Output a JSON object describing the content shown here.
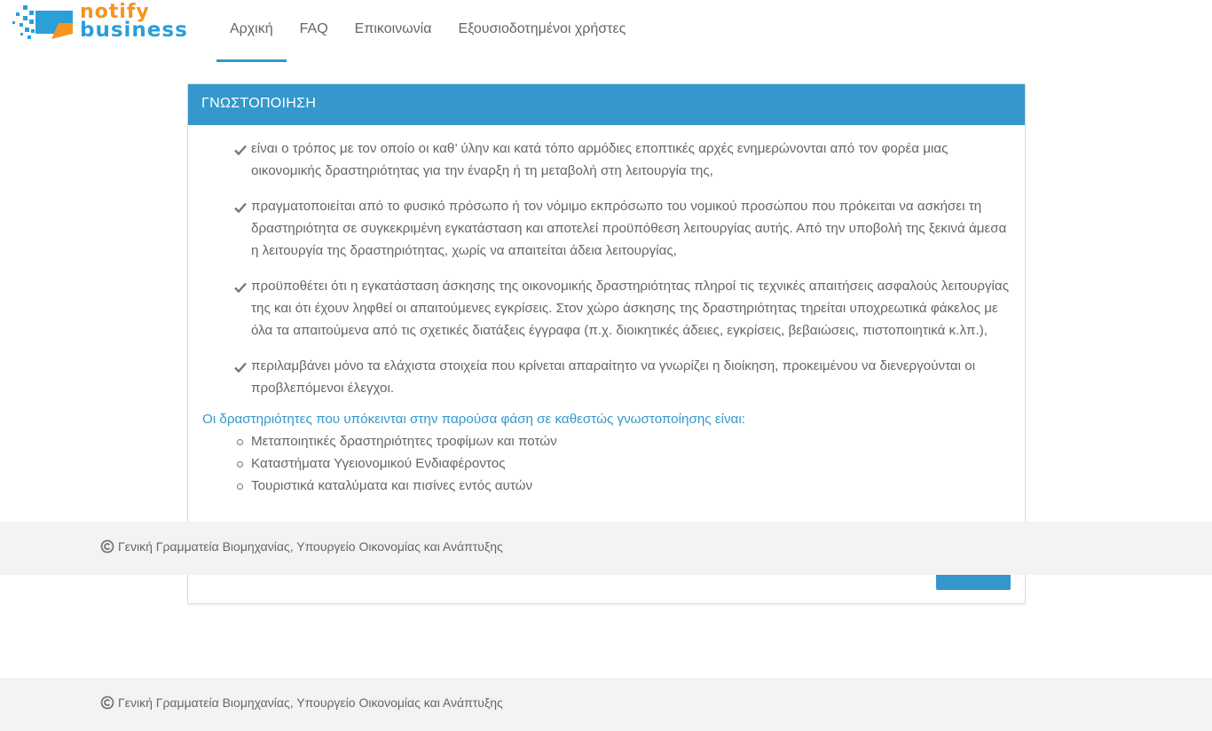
{
  "header": {
    "logo_line1": "notify",
    "logo_line2": "business",
    "nav": [
      {
        "label": "Αρχική",
        "active": true
      },
      {
        "label": "FAQ"
      },
      {
        "label": "Επικοινωνία"
      },
      {
        "label": "Εξουσιοδοτημένοι χρήστες"
      }
    ]
  },
  "panel": {
    "title": "ΓΝΩΣΤΟΠΟΙΗΣΗ",
    "check_items": [
      "είναι ο τρόπος με τον οποίο οι καθ’ ύλην και κατά τόπο αρμόδιες εποπτικές αρχές ενημερώνονται από τον φορέα μιας οικονομικής δραστηριότητας για την έναρξη ή τη μεταβολή στη λειτουργία της,",
      "πραγματοποιείται από το φυσικό πρόσωπο ή τον νόμιμο εκπρόσωπο του νομικού προσώπου που πρόκειται να ασκήσει τη δραστηριότητα σε συγκεκριμένη εγκατάσταση και αποτελεί προϋπόθεση λειτουργίας αυτής. Από την υποβολή της ξεκινά άμεσα η λειτουργία της δραστηριότητας, χωρίς να απαιτείται άδεια λειτουργίας,",
      "προϋποθέτει ότι η εγκατάσταση άσκησης της οικονομικής δραστηριότητας πληροί τις τεχνικές απαιτήσεις ασφαλούς λειτουργίας της και ότι έχουν ληφθεί οι απαιτούμενες εγκρίσεις. Στον χώρο άσκησης της δραστηριότητας τηρείται υποχρεωτικά φάκελος με όλα τα απαιτούμενα από τις σχετικές διατάξεις έγγραφα (π.χ. διοικητικές άδειες, εγκρίσεις, βεβαιώσεις, πιστοποιητικά κ.λπ.),",
      "περιλαμβάνει μόνο τα ελάχιστα στοιχεία που κρίνεται απαραίτητο να γνωρίζει η διοίκηση, προκειμένου να διενεργούνται οι προβλεπόμενοι έλεγχοι."
    ],
    "intro": "Οι δραστηριότητες που υπόκεινται στην παρούσα φάση σε καθεστώς γνωστοποίησης είναι:",
    "bullet_items": [
      "Μεταποιητικές δραστηριότητες τροφίμων και ποτών",
      "Καταστήματα Υγειονομικού Ενδιαφέροντος",
      "Τουριστικά καταλύματα και πισίνες εντός αυτών"
    ]
  },
  "footer": {
    "text": "Γενική Γραμματεία Βιομηχανίας, Υπουργείο Οικονομίας και Ανάπτυξης"
  },
  "colors": {
    "accent": "#3498cc",
    "logo_orange": "#f7941d",
    "logo_blue": "#2a9fd8",
    "footer_bg": "#f3f3f3"
  }
}
